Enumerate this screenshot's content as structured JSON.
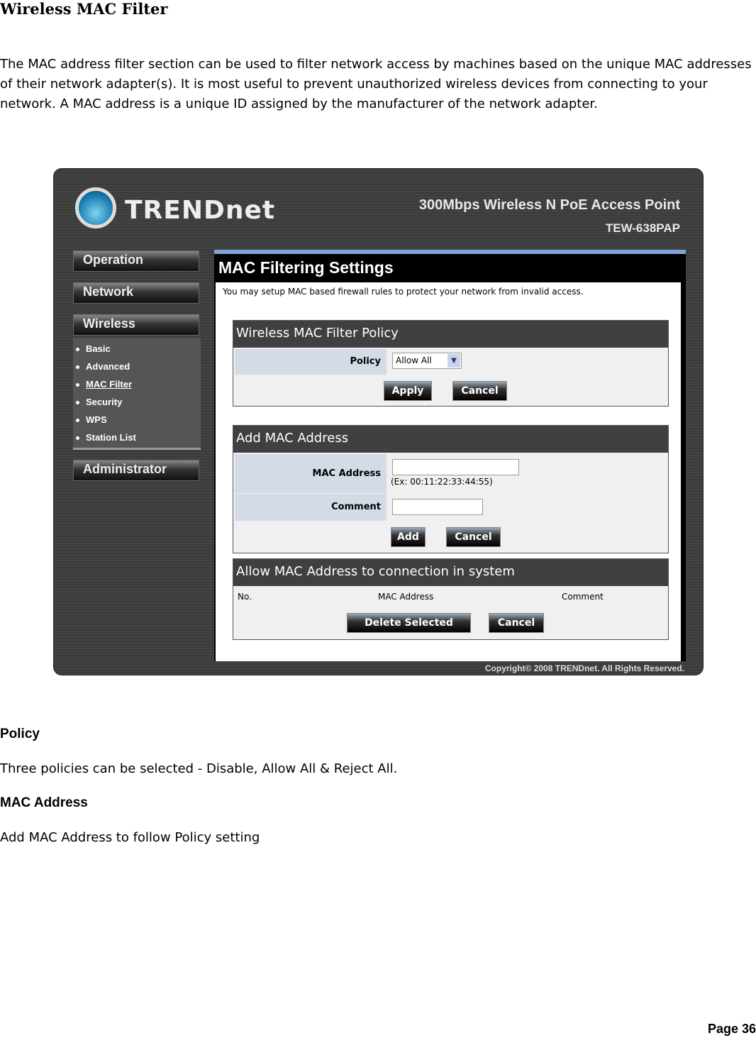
{
  "doc": {
    "title": "Wireless MAC Filter",
    "intro": "The MAC address filter section can be used to filter network access by machines based on the unique MAC addresses of their network adapter(s). It is most useful to prevent unauthorized wireless devices from connecting to your network. A MAC address is a unique ID assigned by the manufacturer of the network adapter.",
    "sections": [
      {
        "heading": "Policy",
        "text": "Three policies can be selected - Disable, Allow All & Reject All."
      },
      {
        "heading": "MAC Address",
        "text": "Add MAC Address to follow Policy setting"
      }
    ],
    "page": "Page  36"
  },
  "ui": {
    "logo": "TRENDnet",
    "product": "300Mbps Wireless N PoE Access Point",
    "model": "TEW-638PAP",
    "nav": [
      "Operation",
      "Network",
      "Wireless",
      "Administrator"
    ],
    "submenu": [
      "Basic",
      "Advanced",
      "MAC Filter",
      "Security",
      "WPS",
      "Station List"
    ],
    "panel_title": "MAC Filtering Settings",
    "panel_desc": "You may setup MAC based firewall rules to protect your network from invalid access.",
    "policy": {
      "header": "Wireless MAC Filter Policy",
      "label": "Policy",
      "value": "Allow All",
      "apply": "Apply",
      "cancel": "Cancel"
    },
    "add": {
      "header": "Add MAC Address",
      "mac_label": "MAC Address",
      "mac_value": "",
      "hint": "(Ex: 00:11:22:33:44:55)",
      "comment_label": "Comment",
      "comment_value": "",
      "add": "Add",
      "cancel": "Cancel"
    },
    "list": {
      "header": "Allow MAC Address to connection in system",
      "columns": [
        "No.",
        "MAC Address",
        "Comment"
      ],
      "delete": "Delete Selected",
      "cancel": "Cancel"
    },
    "copyright": "Copyright© 2008 TRENDnet. All Rights Reserved."
  }
}
